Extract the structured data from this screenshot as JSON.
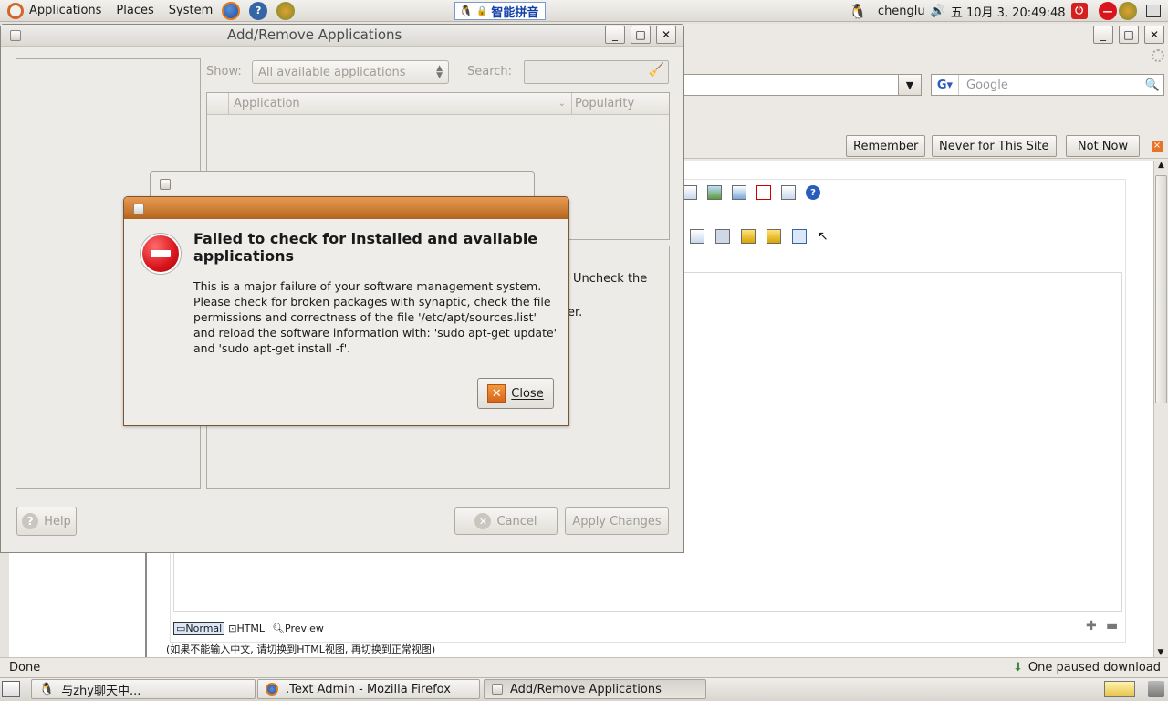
{
  "top_panel": {
    "menus": [
      "Applications",
      "Places",
      "System"
    ],
    "ime_label": "智能拼音",
    "username": "chenglu",
    "clock": "五 10月  3, 20:49:48"
  },
  "firefox": {
    "search_placeholder": "Google",
    "password_bar": {
      "remember": "Remember",
      "never": "Never for This Site",
      "not_now": "Not Now"
    },
    "editor_tabs": [
      "Normal",
      "HTML",
      "Preview"
    ],
    "editor_hint": "(如果不能输入中文, 请切换到HTML视图, 再切换到正常视图)",
    "behind_text_1": "Uncheck the",
    "behind_text_2": "er."
  },
  "status": {
    "left": "Done",
    "right": "One paused download"
  },
  "taskbar": {
    "items": [
      {
        "label": "与zhy聊天中...",
        "active": false
      },
      {
        "label": ".Text Admin - Mozilla Firefox",
        "active": false
      },
      {
        "label": "Add/Remove Applications",
        "active": true
      }
    ]
  },
  "add_remove": {
    "title": "Add/Remove Applications",
    "show_label": "Show:",
    "show_value": "All available applications",
    "search_label": "Search:",
    "columns": [
      "Application",
      "Popularity"
    ],
    "help": "Help",
    "cancel": "Cancel",
    "apply": "Apply Changes"
  },
  "error_dialog": {
    "title": "Failed to check for installed and available applications",
    "body": "This is a major failure of your software management system. Please check for broken packages with synaptic, check the file permissions and correctness of the file '/etc/apt/sources.list' and reload the software information with: 'sudo apt-get update' and 'sudo apt-get install -f'.",
    "close": "Close"
  },
  "colors": {
    "dialog_titlebar": "#c5762c",
    "stop_icon": "#d8141c",
    "panel": "#edebe7"
  }
}
